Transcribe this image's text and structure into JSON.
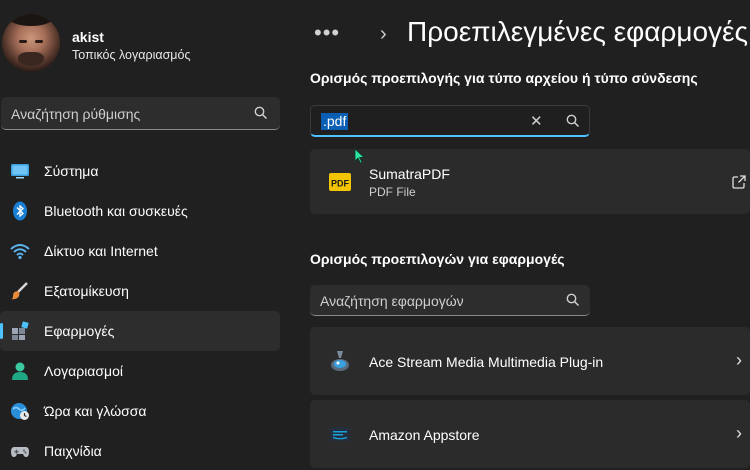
{
  "profile": {
    "name": "akist",
    "account_type": "Τοπικός λογαριασμός"
  },
  "sidebar_search": {
    "placeholder": "Αναζήτηση ρύθμισης",
    "icon": "search-icon"
  },
  "nav": {
    "items": [
      {
        "label": "Σύστημα",
        "icon": "system-icon",
        "active": false
      },
      {
        "label": "Bluetooth και συσκευές",
        "icon": "bluetooth-icon",
        "active": false
      },
      {
        "label": "Δίκτυο και Internet",
        "icon": "wifi-icon",
        "active": false
      },
      {
        "label": "Εξατομίκευση",
        "icon": "brush-icon",
        "active": false
      },
      {
        "label": "Εφαρμογές",
        "icon": "apps-icon",
        "active": true
      },
      {
        "label": "Λογαριασμοί",
        "icon": "person-icon",
        "active": false
      },
      {
        "label": "Ώρα και γλώσσα",
        "icon": "time-language-icon",
        "active": false
      },
      {
        "label": "Παιχνίδια",
        "icon": "gamepad-icon",
        "active": false
      }
    ]
  },
  "header": {
    "more": "•••",
    "separator": "›",
    "title": "Προεπιλεγμένες εφαρμογές"
  },
  "filetype_section": {
    "heading": "Ορισμός προεπιλογής για τύπο αρχείου ή τύπο σύνδεσης",
    "input_value": ".pdf",
    "clear_glyph": "✕",
    "result": {
      "app": "SumatraPDF",
      "type": "PDF File",
      "logo_text": "PDF"
    }
  },
  "apps_section": {
    "heading": "Ορισμός προεπιλογών για εφαρμογές",
    "search_placeholder": "Αναζήτηση εφαρμογών",
    "apps": [
      {
        "name": "Ace Stream Media Multimedia Plug-in",
        "icon": "acestream-icon"
      },
      {
        "name": "Amazon Appstore",
        "icon": "amazon-appstore-icon"
      }
    ],
    "chevron": "›"
  },
  "colors": {
    "background": "#202020",
    "card": "#2b2b2b",
    "accent": "#4cc2ff",
    "selection": "#0a5fb4"
  }
}
